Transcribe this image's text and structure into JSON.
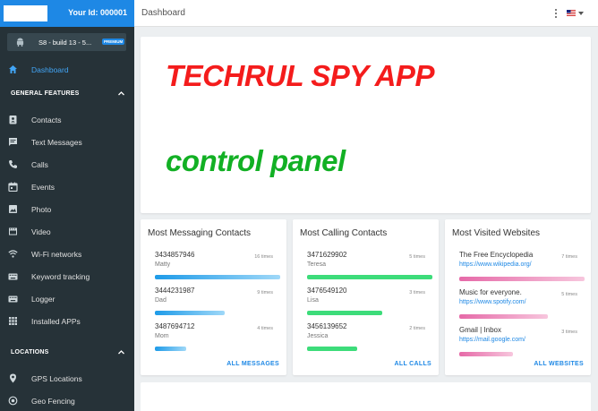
{
  "sidebar": {
    "user_id": "Your Id: 000001",
    "device": {
      "name": "S8 - build 13 - 5...",
      "badge": "PREMIUM"
    },
    "dashboard_label": "Dashboard",
    "general_features_title": "GENERAL FEATURES",
    "items": [
      {
        "label": "Contacts"
      },
      {
        "label": "Text Messages"
      },
      {
        "label": "Calls"
      },
      {
        "label": "Events"
      },
      {
        "label": "Photo"
      },
      {
        "label": "Video"
      },
      {
        "label": "Wi-Fi networks"
      },
      {
        "label": "Keyword tracking"
      },
      {
        "label": "Logger"
      },
      {
        "label": "Installed APPs"
      }
    ],
    "locations_title": "LOCATIONS",
    "location_items": [
      {
        "label": "GPS Locations"
      },
      {
        "label": "Geo Fencing"
      }
    ]
  },
  "topbar": {
    "title": "Dashboard"
  },
  "banner": {
    "line1": "TECHRUL SPY APP",
    "line2": "control panel"
  },
  "cards": {
    "messaging": {
      "title": "Most Messaging Contacts",
      "action": "ALL MESSAGES",
      "rows": [
        {
          "number": "3434857946",
          "name": "Matty",
          "count": "16 times",
          "fraction": 1.0
        },
        {
          "number": "3444231987",
          "name": "Dad",
          "count": "9 times",
          "fraction": 0.56
        },
        {
          "number": "3487694712",
          "name": "Mom",
          "count": "4 times",
          "fraction": 0.25
        }
      ]
    },
    "calling": {
      "title": "Most Calling Contacts",
      "action": "ALL CALLS",
      "rows": [
        {
          "number": "3471629902",
          "name": "Teresa",
          "count": "5 times",
          "fraction": 1.0
        },
        {
          "number": "3476549120",
          "name": "Lisa",
          "count": "3 times",
          "fraction": 0.6
        },
        {
          "number": "3456139652",
          "name": "Jessica",
          "count": "2 times",
          "fraction": 0.4
        }
      ]
    },
    "websites": {
      "title": "Most Visited Websites",
      "action": "ALL WEBSITES",
      "rows": [
        {
          "title": "The Free Encyclopedia",
          "url": "https://www.wikipedia.org/",
          "count": "7 times",
          "fraction": 1.0
        },
        {
          "title": "Music for everyone.",
          "url": "https://www.spotify.com/",
          "count": "5 times",
          "fraction": 0.71
        },
        {
          "title": "Gmail | Inbox",
          "url": "https://mail.google.com/",
          "count": "3 times",
          "fraction": 0.43
        }
      ]
    }
  },
  "colors": {
    "accent": "#1e88e5",
    "sidebar_bg": "#263238",
    "banner_red": "#f41c1c",
    "banner_green": "#12b024",
    "bar_blue": "#29b6f6",
    "bar_green": "#2ecc71",
    "bar_pink": "#e91e63"
  },
  "icons": {
    "device": "android-icon",
    "dashboard": "home-icon",
    "contacts": "contacts-icon",
    "messages": "message-icon",
    "calls": "phone-icon",
    "events": "calendar-icon",
    "photo": "image-icon",
    "video": "film-icon",
    "wifi": "wifi-icon",
    "keyword": "keyboard-icon",
    "logger": "keyboard-icon",
    "apps": "grid-icon",
    "gps": "location-pin-icon",
    "geofence": "target-icon"
  }
}
